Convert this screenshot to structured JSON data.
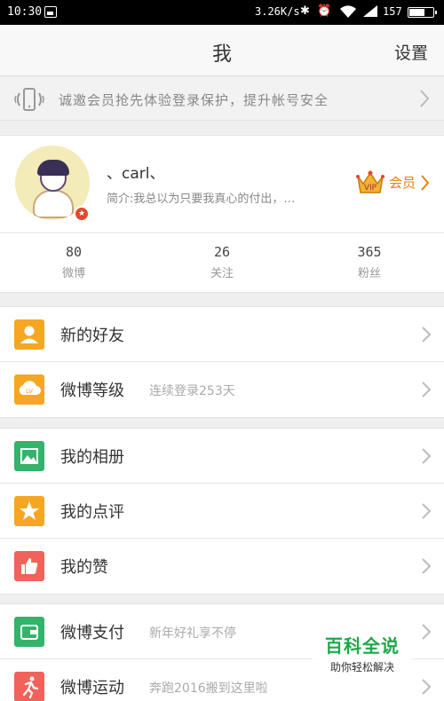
{
  "status_bar": {
    "time": "10:30",
    "net_speed": "3.26K/s",
    "battery": "157",
    "battery_level": 0.62,
    "icons": [
      "gallery-icon",
      "bluetooth-icon",
      "alarm-icon",
      "wifi-icon",
      "battery-icon"
    ]
  },
  "header": {
    "title": "我",
    "settings_label": "设置"
  },
  "banner": {
    "icon": "phone-vibrate-icon",
    "text": "诚邀会员抢先体验登录保护，提升帐号安全"
  },
  "profile": {
    "username": "、carl、",
    "bio": "简介:我总以为只要我真心的付出，…",
    "member_label": "会员",
    "stats": [
      {
        "value": "80",
        "label": "微博"
      },
      {
        "value": "26",
        "label": "关注"
      },
      {
        "value": "365",
        "label": "粉丝"
      }
    ]
  },
  "groups": [
    [
      {
        "label": "新的好友",
        "sub": "",
        "icon": "friend-icon",
        "color": "#f6a623"
      },
      {
        "label": "微博等级",
        "sub": "连续登录253天",
        "icon": "level-icon",
        "color": "#f6a623"
      }
    ],
    [
      {
        "label": "我的相册",
        "sub": "",
        "icon": "album-icon",
        "color": "#35b36a"
      },
      {
        "label": "我的点评",
        "sub": "",
        "icon": "review-icon",
        "color": "#f6a623"
      },
      {
        "label": "我的赞",
        "sub": "",
        "icon": "thumbs-up-icon",
        "color": "#f0625a"
      }
    ],
    [
      {
        "label": "微博支付",
        "sub": "新年好礼享不停",
        "icon": "wallet-icon",
        "color": "#35b36a"
      },
      {
        "label": "微博运动",
        "sub": "奔跑2016搬到这里啦",
        "icon": "running-icon",
        "color": "#f0625a"
      }
    ]
  ],
  "watermark": {
    "title": "百科全说",
    "subtitle": "助你轻松解决"
  },
  "colors": {
    "accent_orange": "#f6a623",
    "accent_green": "#35b36a",
    "accent_red": "#f0625a",
    "member_orange": "#e8820c"
  }
}
